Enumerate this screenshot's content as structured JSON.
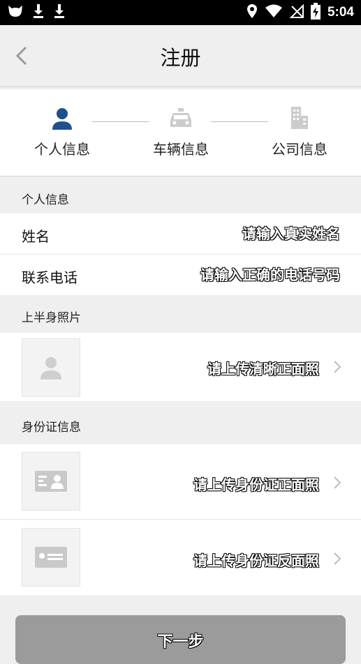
{
  "status_bar": {
    "time": "5:04",
    "left_icons": [
      "cat-icon",
      "download-icon",
      "download-icon"
    ],
    "right_icons": [
      "location-icon",
      "wifi-icon",
      "no-sim-icon",
      "battery-charging-icon"
    ]
  },
  "header": {
    "title": "注册"
  },
  "steps": [
    {
      "label": "个人信息",
      "icon": "person-icon",
      "active": true
    },
    {
      "label": "车辆信息",
      "icon": "car-icon",
      "active": false
    },
    {
      "label": "公司信息",
      "icon": "building-icon",
      "active": false
    }
  ],
  "personal": {
    "section_label": "个人信息",
    "name_label": "姓名",
    "name_placeholder": "请输入真实姓名",
    "phone_label": "联系电话",
    "phone_placeholder": "请输入正确的电话号码"
  },
  "photo": {
    "section_label": "上半身照片",
    "upload_text": "请上传清晰正面照"
  },
  "id_card": {
    "section_label": "身份证信息",
    "front_text": "请上传身份证正面照",
    "back_text": "请上传身份证反面照"
  },
  "next_button": {
    "label": "下一步"
  },
  "colors": {
    "active": "#1e4f8f",
    "inactive": "#cccccc",
    "button": "#9b9b9b"
  }
}
